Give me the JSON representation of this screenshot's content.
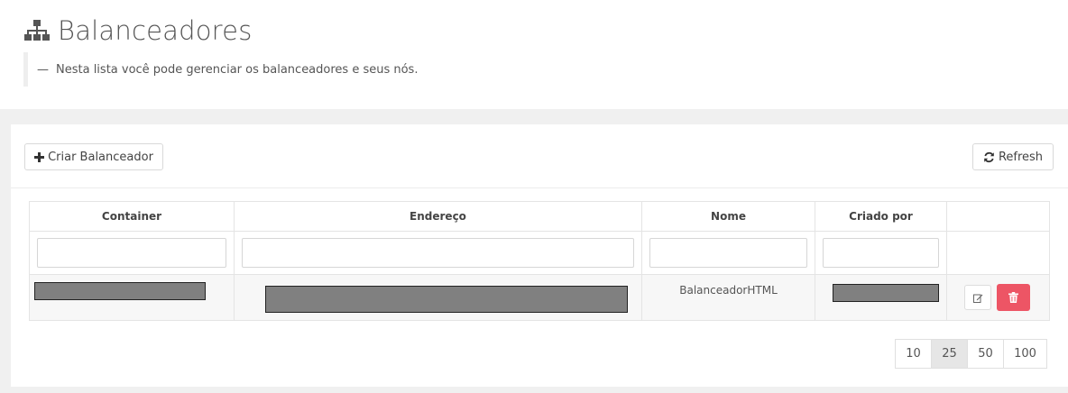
{
  "page": {
    "title": "Balanceadores",
    "description_dash": "—",
    "description": "Nesta lista você pode gerenciar os balanceadores e seus nós."
  },
  "toolbar": {
    "create_label": "Criar Balanceador",
    "refresh_label": "Refresh"
  },
  "table": {
    "columns": [
      "Container",
      "Endereço",
      "Nome",
      "Criado por",
      ""
    ],
    "rows": [
      {
        "container": "",
        "endereco": "",
        "nome": "BalanceadorHTML",
        "criado_por": ""
      }
    ]
  },
  "pager": {
    "options": [
      "10",
      "25",
      "50",
      "100"
    ],
    "selected": "25"
  },
  "colors": {
    "danger": "#ed5565",
    "panel_background": "#f0f0f0",
    "redaction": "#808080"
  },
  "icons": {
    "title": "sitemap-icon",
    "create": "plus-icon",
    "refresh": "refresh-icon",
    "edit": "edit-icon",
    "delete": "trash-icon"
  }
}
